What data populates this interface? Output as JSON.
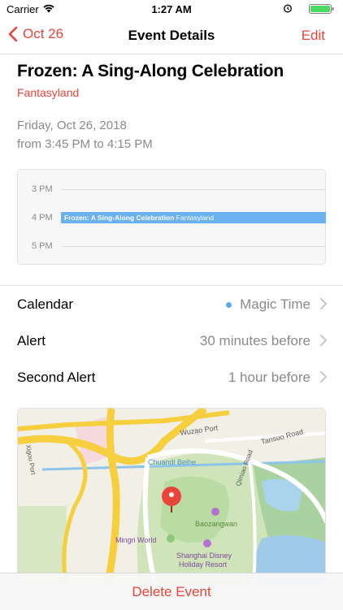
{
  "status_bar": {
    "carrier": "Carrier",
    "time": "1:27 AM"
  },
  "nav": {
    "back_label": "Oct 26",
    "title": "Event Details",
    "edit_label": "Edit"
  },
  "event": {
    "title": "Frozen: A Sing-Along Celebration",
    "location": "Fantasyland",
    "date": "Friday, Oct 26, 2018",
    "time_range": "from 3:45 PM to 4:15 PM"
  },
  "timeline": {
    "hours": [
      "3 PM",
      "4 PM",
      "5 PM"
    ],
    "event_title": "Frozen: A Sing-Along Celebration",
    "event_location": "Fantasyland"
  },
  "rows": [
    {
      "label": "Calendar",
      "value": "Magic Time"
    },
    {
      "label": "Alert",
      "value": "30 minutes before"
    },
    {
      "label": "Second Alert",
      "value": "1 hour before"
    }
  ],
  "map": {
    "labels": {
      "road_1": "Xigou Port",
      "road_2": "Wuzao Port",
      "road_3": "Tansuo Road",
      "road_4": "Chuandi Beihe",
      "road_5": "Qimiao Road",
      "poi_1": "Baozangwan",
      "poi_2": "Mingri World",
      "poi_3": "Shanghai Disney",
      "poi_3b": "Holiday Resort"
    }
  },
  "colors": {
    "accent": "#e8443a",
    "calendar_dot": "#5aa9ea",
    "timeline_event": "#6ab1f1"
  },
  "bottom": {
    "delete_label": "Delete Event"
  }
}
